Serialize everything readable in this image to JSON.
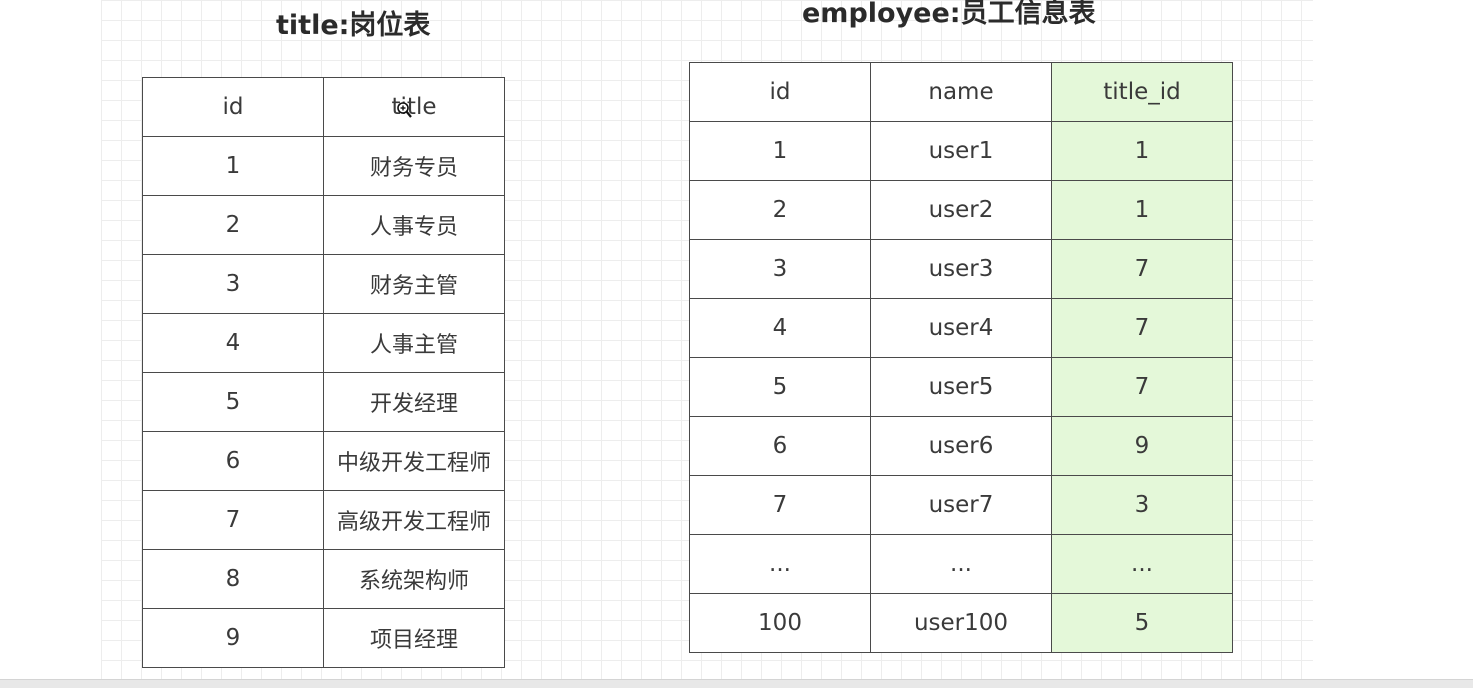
{
  "title_table": {
    "heading": "title:岗位表",
    "columns": [
      "id",
      "title"
    ],
    "rows": [
      {
        "id": "1",
        "title": "财务专员"
      },
      {
        "id": "2",
        "title": "人事专员"
      },
      {
        "id": "3",
        "title": "财务主管"
      },
      {
        "id": "4",
        "title": "人事主管"
      },
      {
        "id": "5",
        "title": "开发经理"
      },
      {
        "id": "6",
        "title": "中级开发工程师"
      },
      {
        "id": "7",
        "title": "高级开发工程师"
      },
      {
        "id": "8",
        "title": "系统架构师"
      },
      {
        "id": "9",
        "title": "项目经理"
      }
    ]
  },
  "employee_table": {
    "heading": "employee:员工信息表",
    "columns": [
      "id",
      "name",
      "title_id"
    ],
    "highlight_color": "#e4f8d9",
    "rows": [
      {
        "id": "1",
        "name": "user1",
        "title_id": "1"
      },
      {
        "id": "2",
        "name": "user2",
        "title_id": "1"
      },
      {
        "id": "3",
        "name": "user3",
        "title_id": "7"
      },
      {
        "id": "4",
        "name": "user4",
        "title_id": "7"
      },
      {
        "id": "5",
        "name": "user5",
        "title_id": "7"
      },
      {
        "id": "6",
        "name": "user6",
        "title_id": "9"
      },
      {
        "id": "7",
        "name": "user7",
        "title_id": "3"
      },
      {
        "id": "...",
        "name": "...",
        "title_id": "..."
      },
      {
        "id": "100",
        "name": "user100",
        "title_id": "5"
      }
    ]
  },
  "cursor": "zoom-in-cursor-icon"
}
